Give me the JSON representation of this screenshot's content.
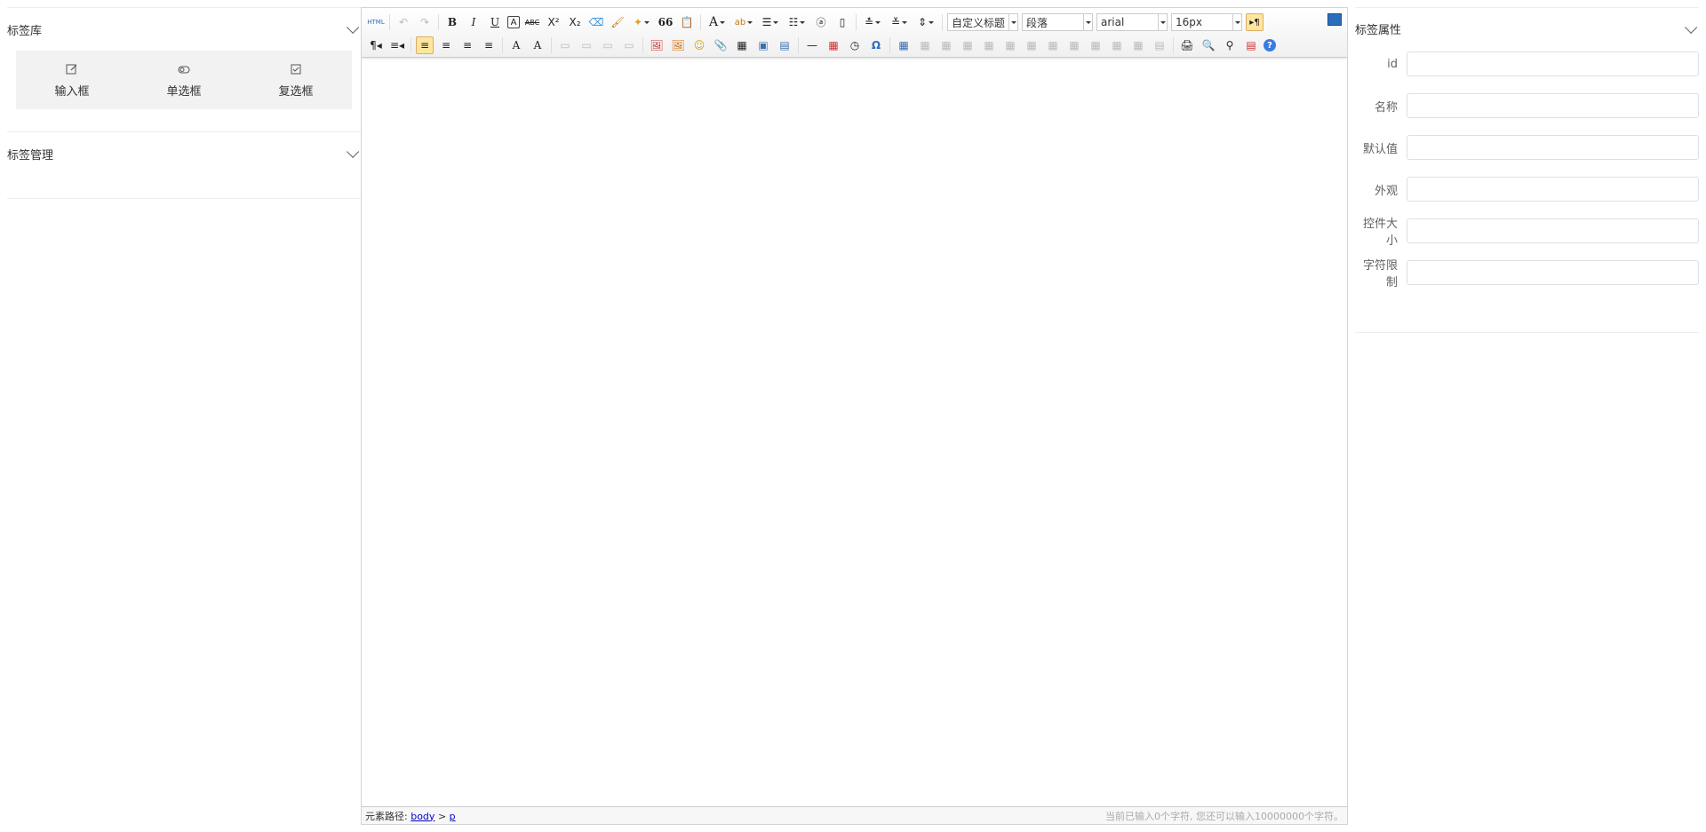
{
  "left": {
    "library_title": "标签库",
    "library_items": [
      {
        "label": "输入框",
        "icon": "edit-icon"
      },
      {
        "label": "单选框",
        "icon": "toggle-icon"
      },
      {
        "label": "复选框",
        "icon": "checkbox-icon"
      }
    ],
    "manage_title": "标签管理"
  },
  "editor": {
    "toolbar": {
      "row1_left": [
        "HTML",
        "↶",
        "↷",
        "B",
        "I",
        "U",
        "A",
        "ABC",
        "X²",
        "X₂",
        "⌫",
        "🖌",
        "✦",
        "66",
        "📋"
      ],
      "combos": {
        "heading": "自定义标题",
        "paragraph": "段落",
        "font": "arial",
        "size": "16px"
      },
      "row2": [
        "¶◂",
        "≡◂",
        "≡",
        "≡",
        "≡",
        "≡",
        "A",
        "A",
        "▭",
        "▭",
        "▭",
        "▭",
        "🖼",
        "🖼",
        "☺",
        "📎",
        "▦",
        "▣",
        "▤",
        "—",
        "▦",
        "◷",
        "Ω",
        "▦",
        "▦",
        "▦",
        "▦",
        "▦",
        "▦",
        "▦",
        "▦",
        "▦",
        "▦",
        "▦",
        "▦",
        "▤",
        "🖨",
        "🔍",
        "⚲",
        "▤",
        "?"
      ]
    },
    "status": {
      "path_label": "元素路径:",
      "path_body": "body",
      "path_sep": ">",
      "path_p": "p",
      "count_text": "当前已输入0个字符, 您还可以输入10000000个字符。"
    }
  },
  "right": {
    "title": "标签属性",
    "fields": [
      {
        "label": "id",
        "value": ""
      },
      {
        "label": "名称",
        "value": ""
      },
      {
        "label": "默认值",
        "value": ""
      },
      {
        "label": "外观",
        "value": ""
      },
      {
        "label": "控件大小",
        "value": ""
      },
      {
        "label": "字符限制",
        "value": ""
      }
    ]
  }
}
